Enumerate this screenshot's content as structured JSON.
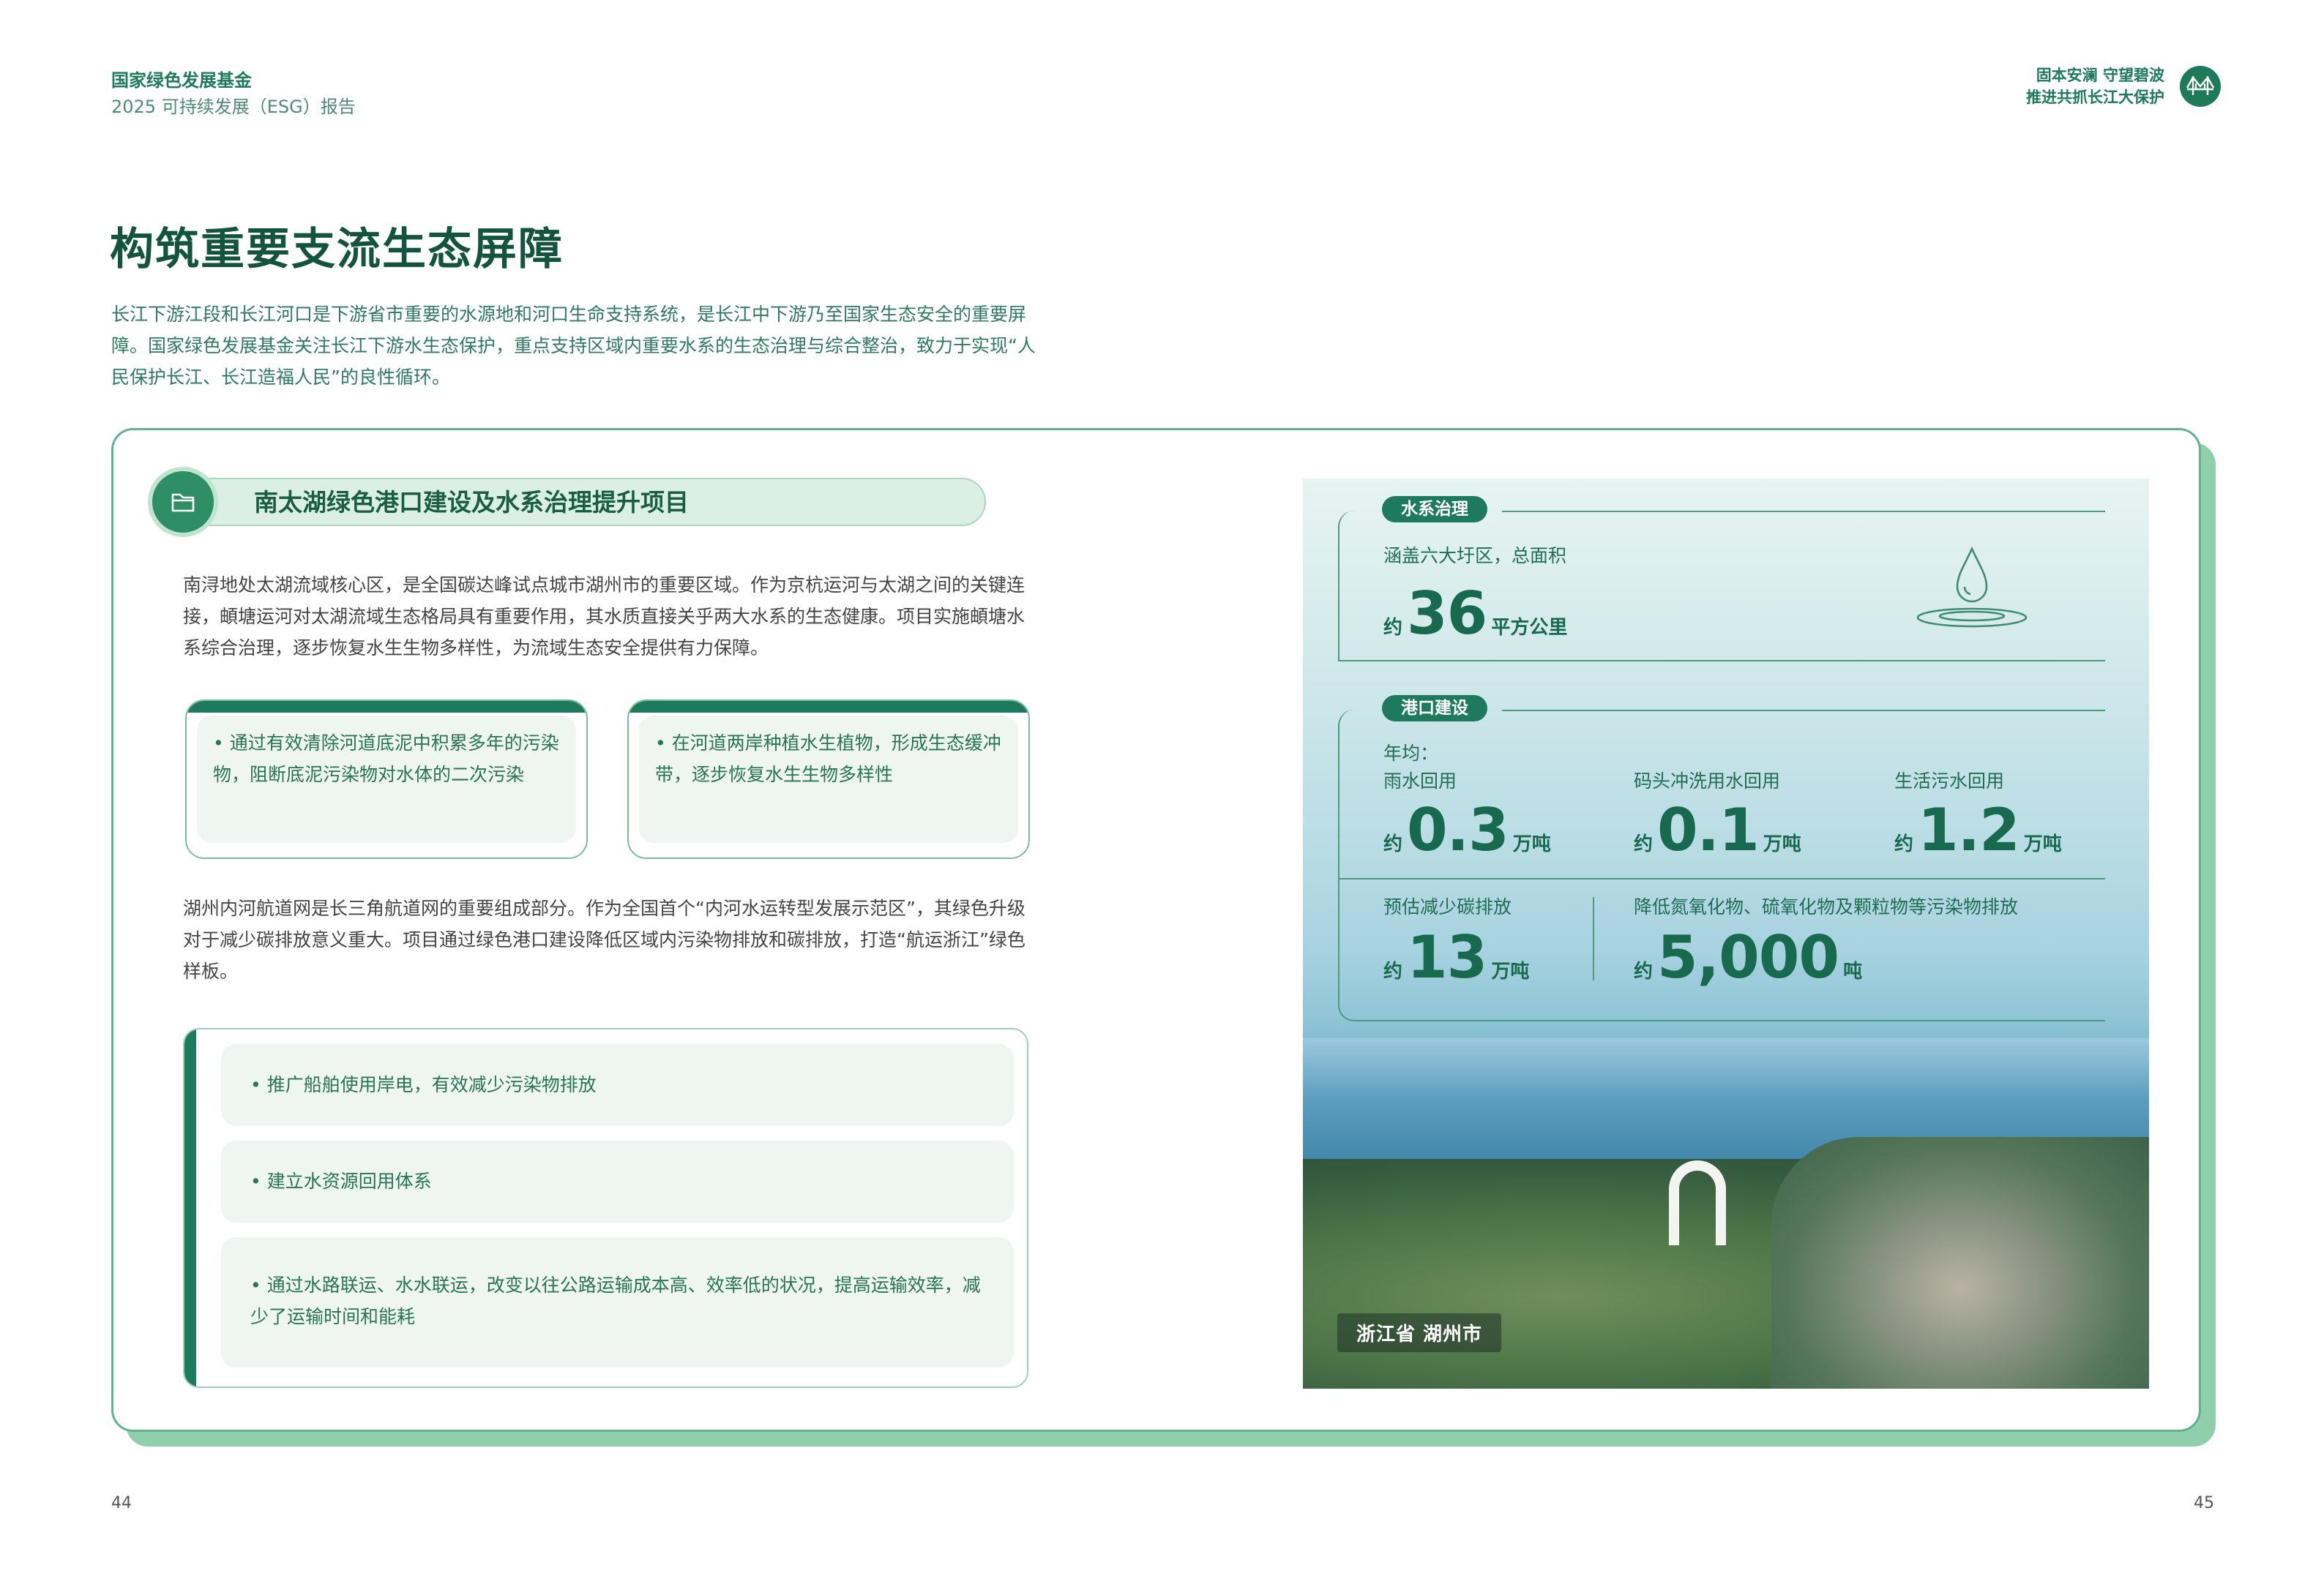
{
  "header": {
    "org": "国家绿色发展基金",
    "report": "2025 可持续发展（ESG）报告",
    "slogan_line1": "固本安澜 守望碧波",
    "slogan_line2": "推进共抓长江大保护",
    "logo_icon": "bridge-icon"
  },
  "page": {
    "title": "构筑重要支流生态屏障",
    "intro": "长江下游江段和长江河口是下游省市重要的水源地和河口生命支持系统，是长江中下游乃至国家生态安全的重要屏障。国家绿色发展基金关注长江下游水生态保护，重点支持区域内重要水系的生态治理与综合整治，致力于实现“人民保护长江、长江造福人民”的良性循环。"
  },
  "project": {
    "icon": "folder-icon",
    "title": "南太湖绿色港口建设及水系治理提升项目",
    "para1": "南浔地处太湖流域核心区，是全国碳达峰试点城市湖州市的重要区域。作为京杭运河与太湖之间的关键连接，頔塘运河对太湖流域生态格局具有重要作用，其水质直接关乎两大水系的生态健康。项目实施頔塘水系综合治理，逐步恢复水生生物多样性，为流域生态安全提供有力保障。",
    "box1": "• 通过有效清除河道底泥中积累多年的污染物，阻断底泥污染物对水体的二次污染",
    "box2": "• 在河道两岸种植水生植物，形成生态缓冲带，逐步恢复水生生物多样性",
    "para2": "湖州内河航道网是长三角航道网的重要组成部分。作为全国首个“内河水运转型发展示范区”，其绿色升级对于减少碳排放意义重大。项目通过绿色港口建设降低区域内污染物排放和碳排放，打造“航运浙江”绿色样板。",
    "measures": [
      "• 推广船舶使用岸电，有效减少污染物排放",
      "• 建立水资源回用体系",
      "• 通过水路联运、水水联运，改变以往公路运输成本高、效率低的状况，提高运输效率，减少了运输时间和能耗"
    ]
  },
  "stats": {
    "water": {
      "tag": "水系治理",
      "label": "涵盖六大圩区，总面积",
      "prefix": "约",
      "value": "36",
      "unit": "平方公里",
      "icon": "water-drop-icon"
    },
    "port": {
      "tag": "港口建设",
      "annual": "年均：",
      "items": [
        {
          "label": "雨水回用",
          "prefix": "约",
          "value": "0.3",
          "unit": "万吨"
        },
        {
          "label": "码头冲洗用水回用",
          "prefix": "约",
          "value": "0.1",
          "unit": "万吨"
        },
        {
          "label": "生活污水回用",
          "prefix": "约",
          "value": "1.2",
          "unit": "万吨"
        }
      ],
      "carbon": {
        "label": "预估减少碳排放",
        "prefix": "约",
        "value": "13",
        "unit": "万吨"
      },
      "pollutants": {
        "label": "降低氮氧化物、硫氧化物及颗粒物等污染物排放",
        "prefix": "约",
        "value": "5,000",
        "unit": "吨"
      }
    }
  },
  "photo": {
    "location": "浙江省  湖州市"
  },
  "footer": {
    "page_left": "44",
    "page_right": "45"
  },
  "colors": {
    "primary": "#1e7a5c",
    "title": "#13543f",
    "light_green": "#dcefe4",
    "card_shadow": "#8fcfab"
  }
}
